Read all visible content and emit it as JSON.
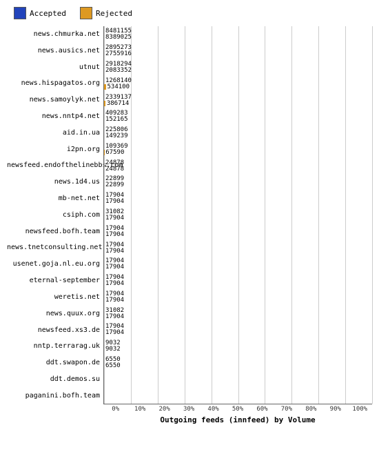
{
  "chart": {
    "title": "Outgoing feeds (innfeed) by Volume",
    "legend": {
      "accepted_label": "Accepted",
      "accepted_color": "#2244bb",
      "rejected_label": "Rejected",
      "rejected_color": "#dd9922"
    },
    "x_ticks": [
      "0%",
      "10%",
      "20%",
      "30%",
      "40%",
      "50%",
      "60%",
      "70%",
      "80%",
      "90%",
      "100%"
    ],
    "max_value": 8481155,
    "rows": [
      {
        "name": "news.chmurka.net",
        "accepted": 8481155,
        "rejected": 8389025
      },
      {
        "name": "news.ausics.net",
        "accepted": 2895273,
        "rejected": 2755916
      },
      {
        "name": "utnut",
        "accepted": 2918294,
        "rejected": 2083352
      },
      {
        "name": "news.hispagatos.org",
        "accepted": 1268140,
        "rejected": 534100
      },
      {
        "name": "news.samoylyk.net",
        "accepted": 2339137,
        "rejected": 386714
      },
      {
        "name": "news.nntp4.net",
        "accepted": 409283,
        "rejected": 152165
      },
      {
        "name": "aid.in.ua",
        "accepted": 225806,
        "rejected": 149239
      },
      {
        "name": "i2pn.org",
        "accepted": 109369,
        "rejected": 67590
      },
      {
        "name": "newsfeed.endofthelinebbs.com",
        "accepted": 24878,
        "rejected": 24878
      },
      {
        "name": "news.1d4.us",
        "accepted": 22899,
        "rejected": 22899
      },
      {
        "name": "mb-net.net",
        "accepted": 17904,
        "rejected": 17904
      },
      {
        "name": "csiph.com",
        "accepted": 31082,
        "rejected": 17904
      },
      {
        "name": "newsfeed.bofh.team",
        "accepted": 17904,
        "rejected": 17904
      },
      {
        "name": "news.tnetconsulting.net",
        "accepted": 17904,
        "rejected": 17904
      },
      {
        "name": "usenet.goja.nl.eu.org",
        "accepted": 17904,
        "rejected": 17904
      },
      {
        "name": "eternal-september",
        "accepted": 17904,
        "rejected": 17904
      },
      {
        "name": "weretis.net",
        "accepted": 17904,
        "rejected": 17904
      },
      {
        "name": "news.quux.org",
        "accepted": 31082,
        "rejected": 17904
      },
      {
        "name": "newsfeed.xs3.de",
        "accepted": 17904,
        "rejected": 17904
      },
      {
        "name": "nntp.terrarag.uk",
        "accepted": 9032,
        "rejected": 9032
      },
      {
        "name": "ddt.swapon.de",
        "accepted": 6550,
        "rejected": 6550
      },
      {
        "name": "ddt.demos.su",
        "accepted": 0,
        "rejected": 0
      },
      {
        "name": "paganini.bofh.team",
        "accepted": 0,
        "rejected": 0
      }
    ]
  }
}
